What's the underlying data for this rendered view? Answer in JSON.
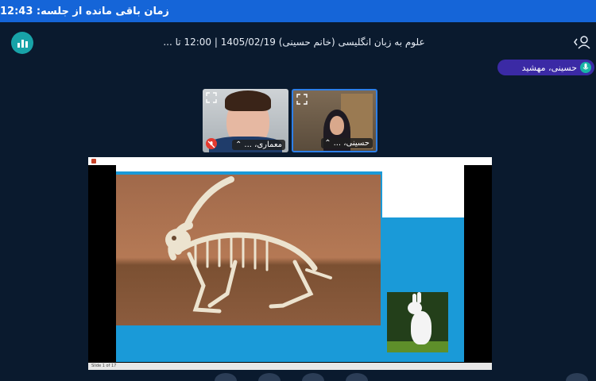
{
  "topbar": {
    "time_remaining_label": "زمان باقی مانده از جلسه: 12:43"
  },
  "header": {
    "meeting_title": "علوم به زبان انگلیسی (خانم حسینی) 1405/02/19 | 12:00 تا ...",
    "app_icon": "stats-bars-icon",
    "user_icon": "user-chevron-icon"
  },
  "presenter": {
    "name": "حسینی، مهشید",
    "icon": "microphone-icon"
  },
  "video_tiles": [
    {
      "name": "معماری، ...",
      "muted": true
    },
    {
      "name": "حسینی، ...",
      "muted": false
    }
  ],
  "shared_screen": {
    "status_text": "Slide 1 of 17",
    "slide_accent": "#1a9ad8"
  },
  "colors": {
    "background": "#0a1a2e",
    "topbar": "#1565d8",
    "presenter_badge": "#3b2aa5",
    "app_icon": "#18a3a8",
    "muted": "#e4392f"
  }
}
